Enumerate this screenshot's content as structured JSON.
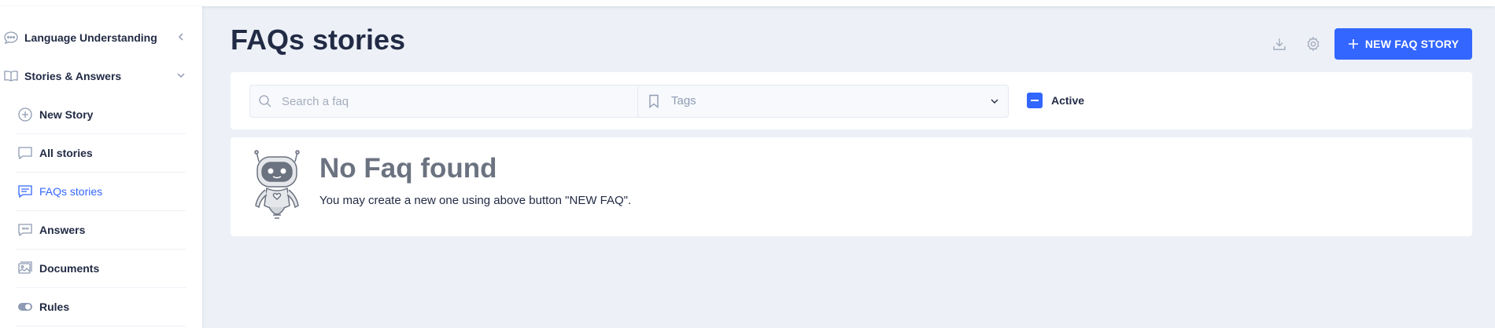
{
  "sidebar": {
    "sections": [
      {
        "label": "Language Understanding",
        "icon": "chat-bubble-icon",
        "state": "collapsed"
      },
      {
        "label": "Stories & Answers",
        "icon": "book-open-icon",
        "state": "expanded"
      }
    ],
    "items": [
      {
        "label": "New Story",
        "icon": "plus-circle-icon"
      },
      {
        "label": "All stories",
        "icon": "message-square-icon"
      },
      {
        "label": "FAQs stories",
        "icon": "message-lines-icon",
        "active": true
      },
      {
        "label": "Answers",
        "icon": "quote-icon"
      },
      {
        "label": "Documents",
        "icon": "images-icon"
      },
      {
        "label": "Rules",
        "icon": "toggle-icon"
      }
    ]
  },
  "header": {
    "title": "FAQs stories",
    "new_button_label": "NEW FAQ STORY"
  },
  "filters": {
    "search_placeholder": "Search a faq",
    "tags_placeholder": "Tags",
    "active_label": "Active",
    "active_state": "indeterminate"
  },
  "empty_state": {
    "title": "No Faq found",
    "message": "You may create a new one using above button \"NEW FAQ\"."
  },
  "colors": {
    "primary": "#3366ff",
    "background": "#edf1f7",
    "text": "#222b45",
    "muted": "#8f9bb3"
  }
}
